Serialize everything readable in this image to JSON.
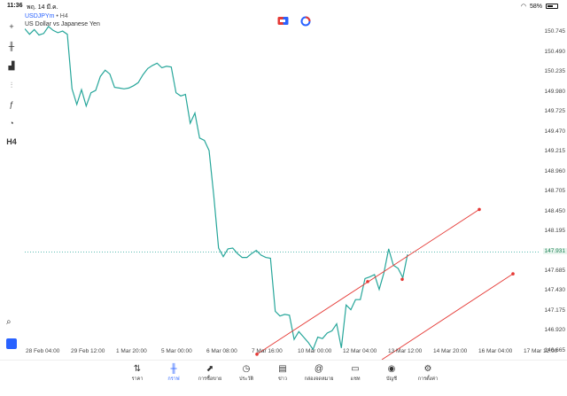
{
  "status_bar": {
    "time": "11:36",
    "date": "พฤ. 14 มี.ค.",
    "battery": "58%",
    "battery_level": 0.58
  },
  "symbol": {
    "name": "USDJPYm",
    "timeframe": "• H4",
    "description": "US Dollar vs Japanese Yen"
  },
  "left_toolbar": [
    {
      "name": "crosshair-icon",
      "glyph": "+"
    },
    {
      "name": "candlestick-icon",
      "glyph": "╫"
    },
    {
      "name": "indicators-icon",
      "glyph": "▟"
    },
    {
      "name": "settings-sliders-icon",
      "glyph": "⫶"
    },
    {
      "name": "function-icon",
      "glyph": "ƒ"
    },
    {
      "name": "shapes-icon",
      "glyph": "◔"
    },
    {
      "name": "timeframe-label",
      "glyph": "H4"
    }
  ],
  "top_icons": [
    {
      "name": "trade-icon"
    },
    {
      "name": "history-icon"
    }
  ],
  "chart_data": {
    "type": "line",
    "series": [
      {
        "values": [
          150.79,
          150.72,
          150.78,
          150.71,
          150.73,
          150.82,
          150.77,
          150.74,
          150.76,
          150.72,
          150.02,
          149.82,
          150.01,
          149.8,
          149.97,
          150.0,
          150.18,
          150.26,
          150.21,
          150.04,
          150.03,
          150.02,
          150.03,
          150.06,
          150.1,
          150.2,
          150.28,
          150.32,
          150.35,
          150.29,
          150.31,
          150.3,
          149.97,
          149.93,
          149.95,
          149.58,
          149.71,
          149.39,
          149.36,
          149.23,
          148.65,
          147.98,
          147.87,
          147.97,
          147.98,
          147.91,
          147.86,
          147.86,
          147.91,
          147.95,
          147.89,
          147.86,
          147.85,
          147.17,
          147.11,
          147.13,
          147.12,
          146.81,
          146.91,
          146.84,
          146.77,
          146.68,
          146.84,
          146.82,
          146.89,
          146.92,
          147.01,
          146.7,
          147.25,
          147.19,
          147.32,
          147.32,
          147.59,
          147.61,
          147.64,
          147.45,
          147.66,
          147.97,
          147.76,
          147.72,
          147.6,
          147.9
        ]
      }
    ],
    "y_axis_labels": [
      "150.745",
      "150.490",
      "150.235",
      "149.980",
      "149.725",
      "149.470",
      "149.215",
      "148.960",
      "148.705",
      "148.450",
      "148.195",
      "147.685",
      "147.430",
      "147.175",
      "146.920",
      "146.665"
    ],
    "current_price": "147.931",
    "x_axis_labels": [
      "28 Feb 04:00",
      "29 Feb 12:00",
      "1 Mar 20:00",
      "5 Mar 00:00",
      "6 Mar 08:00",
      "7 Mar 16:00",
      "10 Mar 00:00",
      "12 Mar 04:00",
      "13 Mar 12:00",
      "14 Mar 20:00",
      "16 Mar 04:00",
      "17 Mar 12:00"
    ],
    "ylim": [
      146.55,
      151.0
    ],
    "grid": false,
    "colors": {
      "line": "#26a69a",
      "current_price_line": "#26a69a",
      "trendline": "#e53935"
    }
  },
  "bottom_nav": [
    {
      "label": "ราคา",
      "icon": "quotes-icon",
      "glyph": "⇅",
      "active": false
    },
    {
      "label": "กราฟ",
      "icon": "chart-icon",
      "glyph": "╫",
      "active": true
    },
    {
      "label": "การซื้อขาย",
      "icon": "trade-icon",
      "glyph": "⬈",
      "active": false
    },
    {
      "label": "ประวัติ",
      "icon": "history-icon",
      "glyph": "◷",
      "active": false
    },
    {
      "label": "ข่าว",
      "icon": "news-icon",
      "glyph": "▤",
      "active": false
    },
    {
      "label": "กล่องจดหมาย",
      "icon": "mailbox-icon",
      "glyph": "@",
      "active": false
    },
    {
      "label": "แชท",
      "icon": "chat-icon",
      "glyph": "▭",
      "active": false
    },
    {
      "label": "บัญชี",
      "icon": "account-icon",
      "glyph": "◉",
      "active": false
    },
    {
      "label": "การตั้งค่า",
      "icon": "settings-icon",
      "glyph": "⚙",
      "active": false
    }
  ]
}
